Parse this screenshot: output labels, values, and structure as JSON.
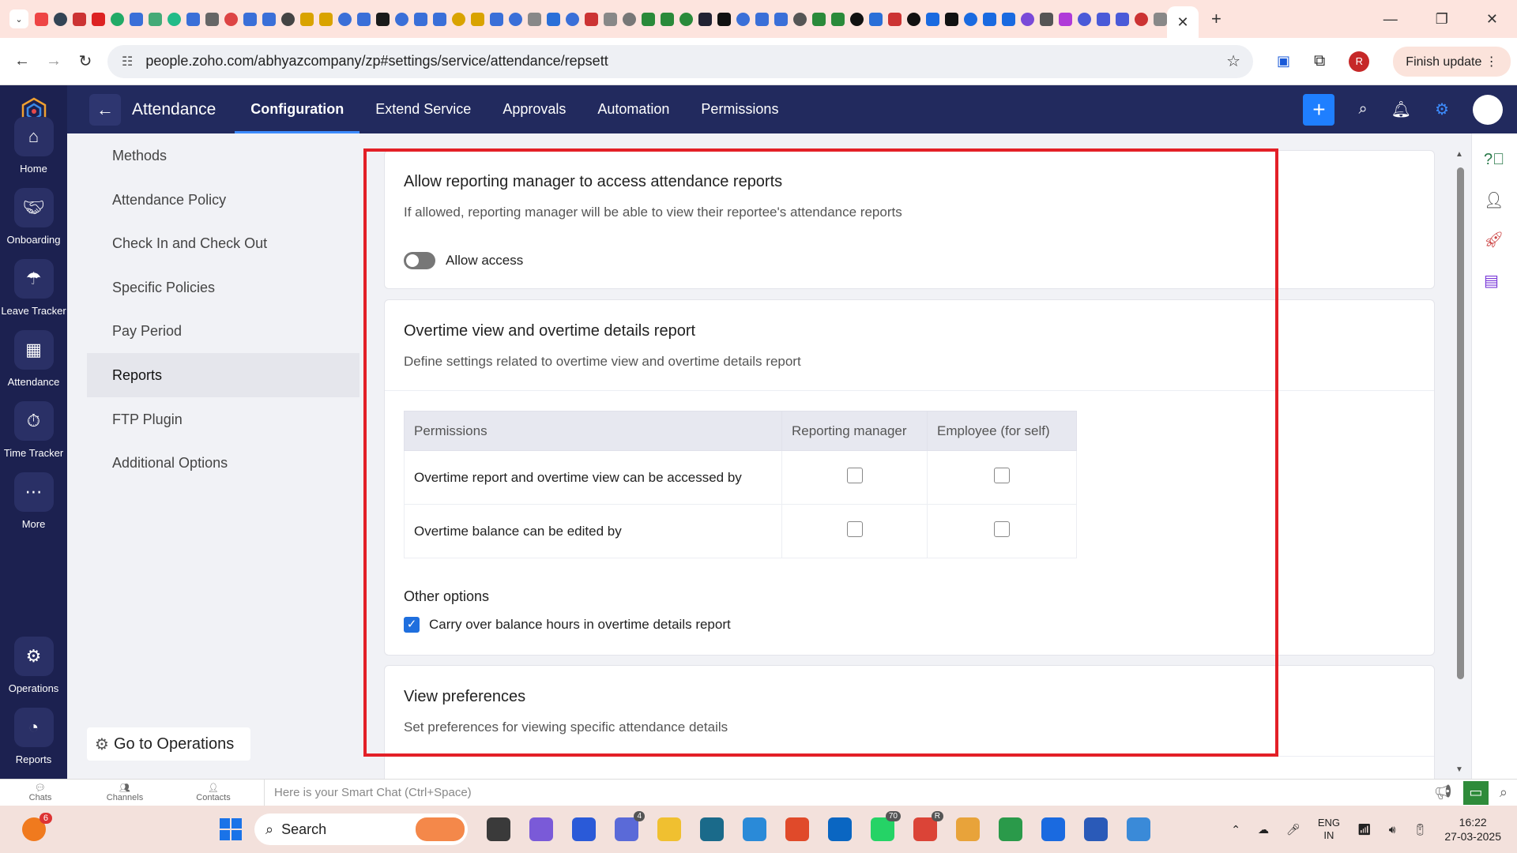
{
  "browser": {
    "url": "people.zoho.com/abhyazcompany/zp#settings/service/attendance/repsett",
    "finish_update": "Finish update",
    "profile_initial": "R",
    "tab_colors": [
      "#e44",
      "#345",
      "#c33",
      "#d22",
      "#2a6",
      "#3a6fd8",
      "#4a7",
      "#2b8",
      "#3a6fd8",
      "#666",
      "#d44",
      "#3a6fd8",
      "#3a6fd8",
      "#444",
      "#d9a300",
      "#d9a300",
      "#3a6fd8",
      "#3a6fd8",
      "#1a1a1a",
      "#3a6fd8",
      "#3a6fd8",
      "#3a6fd8",
      "#d9a300",
      "#d9a300",
      "#3a6fd8",
      "#3a6fd8",
      "#888",
      "#2a6fd8",
      "#3a6fd8",
      "#c33",
      "#888",
      "#777",
      "#2a8a3a",
      "#2a8a3a",
      "#2a8a3a",
      "#223",
      "#111",
      "#3a6fd8",
      "#3a6fd8",
      "#3a6fd8",
      "#555",
      "#2a8a3a",
      "#2a8a3a",
      "#111",
      "#2a6fd8",
      "#c33",
      "#111",
      "#1a6ae0",
      "#111",
      "#1a6ae0",
      "#1a6ae0",
      "#1a6ae0",
      "#7a4ad8",
      "#555",
      "#b03ad8",
      "#4a5ad8",
      "#4a5ad8",
      "#4a5ad8",
      "#c33",
      "#888"
    ]
  },
  "rail": {
    "items": [
      {
        "label": "Home",
        "icon": "home-icon"
      },
      {
        "label": "Onboarding",
        "icon": "handshake-icon"
      },
      {
        "label": "Leave Tracker",
        "icon": "umbrella-icon"
      },
      {
        "label": "Attendance",
        "icon": "calendar-icon"
      },
      {
        "label": "Time Tracker",
        "icon": "timer-icon"
      },
      {
        "label": "More",
        "icon": "more-icon"
      },
      {
        "label": "Operations",
        "icon": "operations-icon"
      },
      {
        "label": "Reports",
        "icon": "pie-chart-icon"
      }
    ]
  },
  "topnav": {
    "module_title": "Attendance",
    "tabs": [
      "Configuration",
      "Extend Service",
      "Approvals",
      "Automation",
      "Permissions"
    ],
    "active_tab": "Configuration"
  },
  "sidemenu": {
    "items": [
      "Methods",
      "Attendance Policy",
      "Check In and Check Out",
      "Specific Policies",
      "Pay Period",
      "Reports",
      "FTP Plugin",
      "Additional Options"
    ],
    "selected": "Reports",
    "goto_operations": "Go to Operations"
  },
  "sections": {
    "manager_access": {
      "title": "Allow reporting manager to access attendance reports",
      "description": "If allowed, reporting manager will be able to view their reportee's attendance reports",
      "toggle_label": "Allow access",
      "toggle_on": false
    },
    "overtime": {
      "title": "Overtime view and overtime details report",
      "description": "Define settings related to overtime view and overtime details report",
      "table": {
        "headers": [
          "Permissions",
          "Reporting manager",
          "Employee (for self)"
        ],
        "rows": [
          {
            "label": "Overtime report and overtime view can be accessed by",
            "reporting_manager": false,
            "employee": false
          },
          {
            "label": "Overtime balance can be edited by",
            "reporting_manager": false,
            "employee": false
          }
        ]
      },
      "other_options_title": "Other options",
      "carry_over_label": "Carry over balance hours in overtime details report",
      "carry_over_checked": true
    },
    "view_prefs": {
      "title": "View preferences",
      "description": "Set preferences for viewing specific attendance details"
    }
  },
  "chatbar": {
    "items": [
      "Chats",
      "Channels",
      "Contacts"
    ],
    "placeholder": "Here is your Smart Chat (Ctrl+Space)"
  },
  "taskbar": {
    "weather_badge": "6",
    "search_label": "Search",
    "teams_badge": "4",
    "whatsapp_badge": "70",
    "profile_badge": "R",
    "language": "ENG",
    "region": "IN",
    "time": "16:22",
    "date": "27-03-2025",
    "app_colors": [
      "#3a3a3a",
      "#7a5ad8",
      "#2a5ad8",
      "#5a6ad8",
      "#f0c030",
      "#1a6a8a",
      "#2a8ad8",
      "#e04a2a",
      "#0a66c2",
      "#25d366",
      "#db4437",
      "#e8a33a",
      "#2a9a4a",
      "#1a6ae0",
      "#2a5ab8",
      "#3a8ad8"
    ]
  },
  "highlight_color": "#e32027",
  "accent_color": "#1f7fff"
}
